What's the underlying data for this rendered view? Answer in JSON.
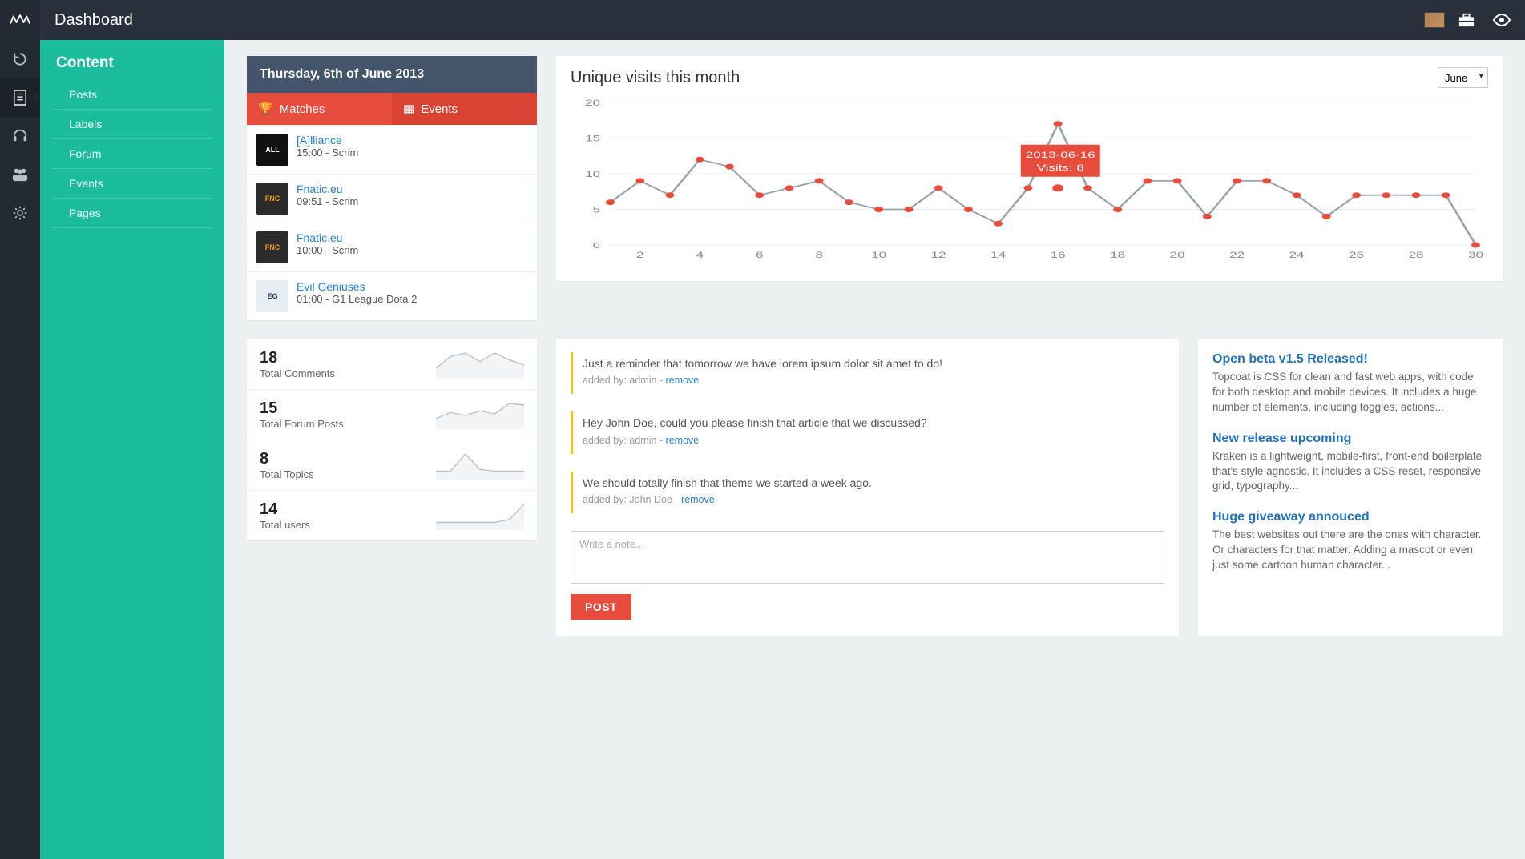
{
  "page_title": "Dashboard",
  "sidepanel": {
    "heading": "Content",
    "items": [
      "Posts",
      "Labels",
      "Forum",
      "Events",
      "Pages"
    ]
  },
  "schedule": {
    "date_header": "Thursday, 6th of June 2013",
    "tabs": {
      "matches": "Matches",
      "events": "Events"
    },
    "rows": [
      {
        "team": "[A]lliance",
        "sub": "15:00 - Scrim",
        "logo_bg": "#111",
        "logo_text": "ALL"
      },
      {
        "team": "Fnatic.eu",
        "sub": "09:51 - Scrim",
        "logo_bg": "#2b2b2b",
        "logo_text": "FNC",
        "logo_accent": "#f39c12"
      },
      {
        "team": "Fnatic.eu",
        "sub": "10:00 - Scrim",
        "logo_bg": "#2b2b2b",
        "logo_text": "FNC",
        "logo_accent": "#f39c12"
      },
      {
        "team": "Evil Geniuses",
        "sub": "01:00 - G1 League Dota 2",
        "logo_bg": "#e7eef3",
        "logo_text": "EG",
        "logo_fg": "#1b3a6a"
      }
    ]
  },
  "chart": {
    "title": "Unique visits this month",
    "month_selected": "June"
  },
  "chart_data": {
    "type": "line",
    "title": "Unique visits this month",
    "xlabel": "",
    "ylabel": "",
    "ylim": [
      0,
      20
    ],
    "xtick_labels": [
      "2",
      "4",
      "6",
      "8",
      "10",
      "12",
      "14",
      "16",
      "18",
      "20",
      "22",
      "24",
      "26",
      "28",
      "30"
    ],
    "x": [
      1,
      2,
      3,
      4,
      5,
      6,
      7,
      8,
      9,
      10,
      11,
      12,
      13,
      14,
      15,
      16,
      17,
      18,
      19,
      20,
      21,
      22,
      23,
      24,
      25,
      26,
      27,
      28,
      29,
      30
    ],
    "values": [
      6,
      9,
      7,
      12,
      11,
      7,
      8,
      9,
      6,
      5,
      5,
      8,
      5,
      3,
      8,
      17,
      8,
      5,
      9,
      9,
      4,
      9,
      9,
      7,
      4,
      7,
      7,
      7,
      7,
      0
    ],
    "tooltip": {
      "x": 16,
      "date": "2013-06-16",
      "label": "Visits: 8",
      "point_y": 8
    },
    "grid": true
  },
  "stats": [
    {
      "value": "18",
      "label": "Total Comments",
      "spark": [
        5,
        12,
        14,
        9,
        14,
        10,
        7
      ]
    },
    {
      "value": "15",
      "label": "Total Forum Posts",
      "spark": [
        6,
        10,
        8,
        11,
        9,
        16,
        15
      ]
    },
    {
      "value": "8",
      "label": "Total Topics",
      "spark": [
        4,
        4,
        14,
        5,
        4,
        4,
        4
      ]
    },
    {
      "value": "14",
      "label": "Total users",
      "spark": [
        4,
        4,
        4,
        4,
        4,
        6,
        16
      ]
    }
  ],
  "notes": {
    "items": [
      {
        "body": "Just a reminder that tomorrow we have lorem ipsum dolor sit amet to do!",
        "author": "admin"
      },
      {
        "body": "Hey John Doe, could you please finish that article that we discussed?",
        "author": "admin"
      },
      {
        "body": "We should totally finish that theme we started a week ago.",
        "author": "John Doe"
      }
    ],
    "meta_prefix": "added by: ",
    "remove_label": "remove",
    "placeholder": "Write a note...",
    "post_label": "POST"
  },
  "news": [
    {
      "title": "Open beta v1.5 Released!",
      "body": "Topcoat is CSS for clean and fast web apps, with code for both desktop and mobile devices. It includes a huge number of elements, including toggles, actions..."
    },
    {
      "title": "New release upcoming",
      "body": "Kraken is a lightweight, mobile-first, front-end boilerplate that's style agnostic. It includes a CSS reset, responsive grid, typography..."
    },
    {
      "title": "Huge giveaway annouced",
      "body": "The best websites out there are the ones with character. Or characters for that matter. Adding a mascot or even just some cartoon human character..."
    }
  ]
}
